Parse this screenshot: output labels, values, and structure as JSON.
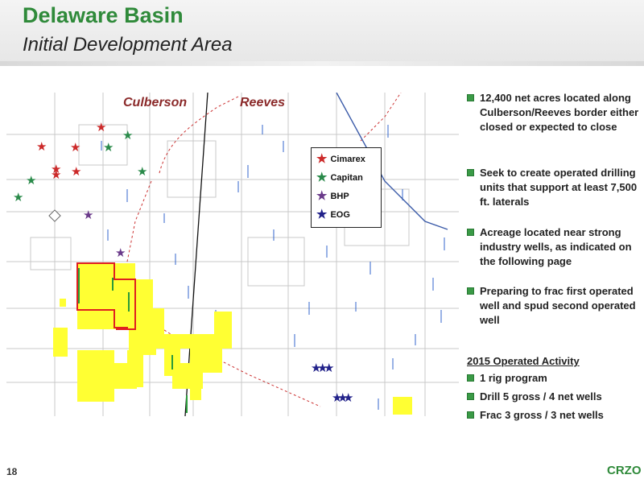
{
  "header": {
    "title": "Delaware Basin",
    "subtitle": "Initial Development Area"
  },
  "map": {
    "county_left": "Culberson",
    "county_right": "Reeves",
    "legend": [
      {
        "label": "Cimarex",
        "color": "#cc2a2a"
      },
      {
        "label": "Capitan",
        "color": "#2a8a4a"
      },
      {
        "label": "BHP",
        "color": "#6a3a8a"
      },
      {
        "label": "EOG",
        "color": "#22228a"
      }
    ],
    "colors": {
      "acreage": "#ffff33",
      "outline": "#e02020",
      "grid": "#c8c8c8",
      "wells": "#3366cc"
    }
  },
  "bullets": [
    "12,400 net acres located along Culberson/Reeves border either closed or expected to close",
    "Seek to create operated drilling units that support at least 7,500 ft. laterals",
    "Acreage located near strong industry wells, as indicated on the following page",
    "Preparing to frac first operated well and spud second operated well"
  ],
  "activity": {
    "title": "2015 Operated Activity",
    "items": [
      "1 rig program",
      "Drill 5 gross / 4 net wells",
      "Frac 3 gross / 3 net wells"
    ]
  },
  "footer": {
    "page_number": "18",
    "logo": "CRZO"
  }
}
